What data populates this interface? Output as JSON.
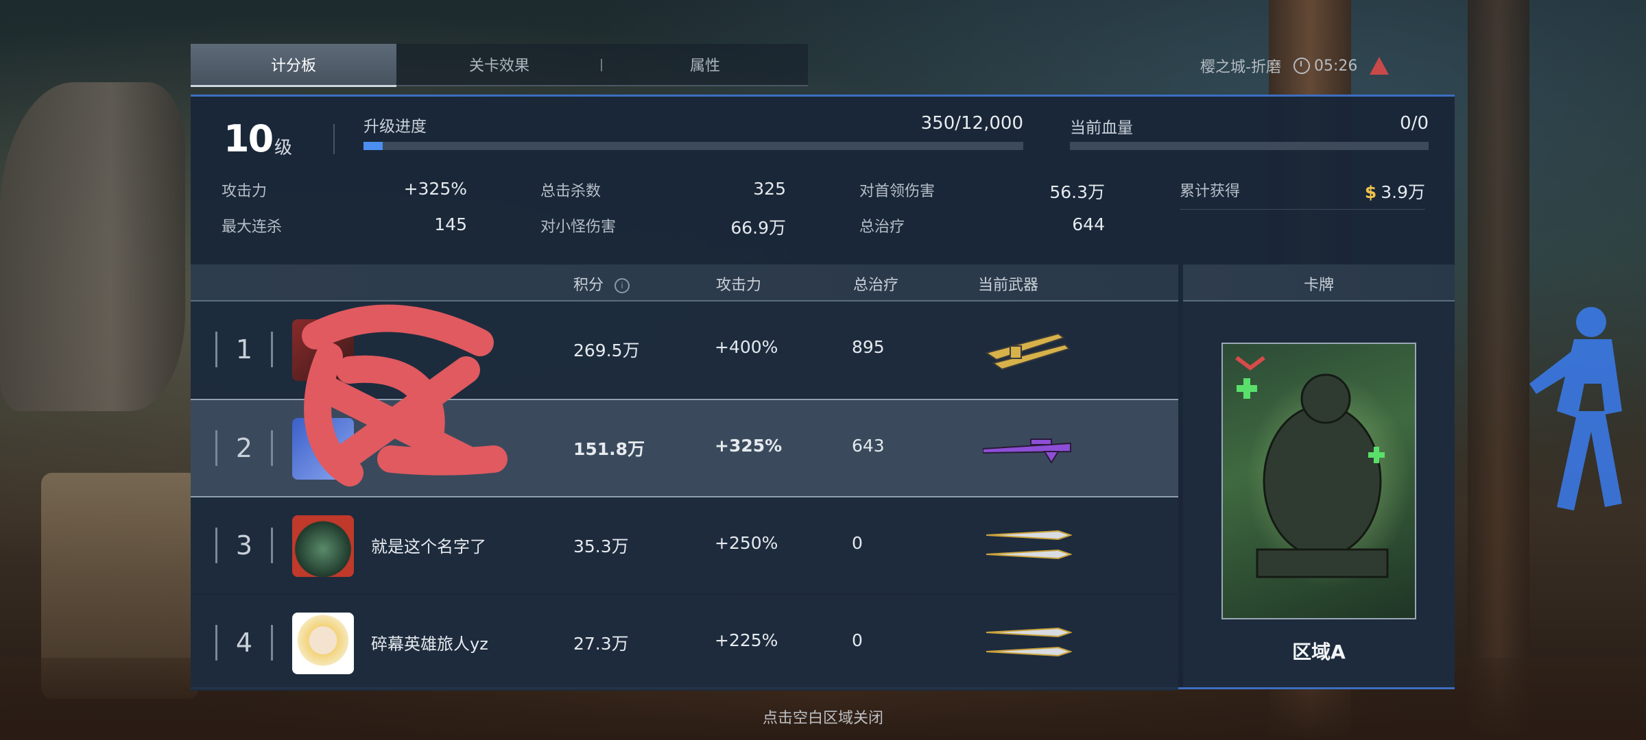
{
  "tabs": [
    {
      "label": "计分板",
      "active": true
    },
    {
      "label": "关卡效果",
      "active": false
    },
    {
      "label": "属性",
      "active": false
    }
  ],
  "top_right": {
    "location": "樱之城-折磨",
    "timer": "05:26"
  },
  "level": {
    "number": "10",
    "unit": "级"
  },
  "progress": {
    "label": "升级进度",
    "value_text": "350/12,000",
    "fraction": 0.029
  },
  "health": {
    "label": "当前血量",
    "value_text": "0/0",
    "fraction": 0
  },
  "stats": [
    {
      "key": "攻击力",
      "value": "+325%"
    },
    {
      "key": "总击杀数",
      "value": "325"
    },
    {
      "key": "对首领伤害",
      "value": "56.3万"
    },
    {
      "key": "累计获得",
      "value": "3.9万",
      "currency_icon": "$"
    },
    {
      "key": "最大连杀",
      "value": "145"
    },
    {
      "key": "对小怪伤害",
      "value": "66.9万"
    },
    {
      "key": "总治疗",
      "value": "644"
    }
  ],
  "table": {
    "headers": {
      "score": "积分",
      "attack": "攻击力",
      "heal": "总治疗",
      "weapon": "当前武器",
      "card": "卡牌"
    },
    "rows": [
      {
        "rank": "1",
        "name": "",
        "score": "269.5万",
        "attack": "+400%",
        "heal": "895",
        "weapon": "gold-dual-rifle"
      },
      {
        "rank": "2",
        "name": "",
        "score": "151.8万",
        "attack": "+325%",
        "heal": "643",
        "weapon": "purple-sniper",
        "highlight": true
      },
      {
        "rank": "3",
        "name": "就是这个名字了",
        "score": "35.3万",
        "attack": "+250%",
        "heal": "0",
        "weapon": "twin-daggers"
      },
      {
        "rank": "4",
        "name": "碎幕英雄旅人yz",
        "score": "27.3万",
        "attack": "+225%",
        "heal": "0",
        "weapon": "twin-daggers"
      }
    ]
  },
  "card": {
    "title": "区域A"
  },
  "close_hint": "点击空白区域关闭",
  "colors": {
    "accent_blue": "#4b8ff0",
    "gold": "#f1c44c",
    "panel": "#182638",
    "redaction": "#e05a60"
  }
}
